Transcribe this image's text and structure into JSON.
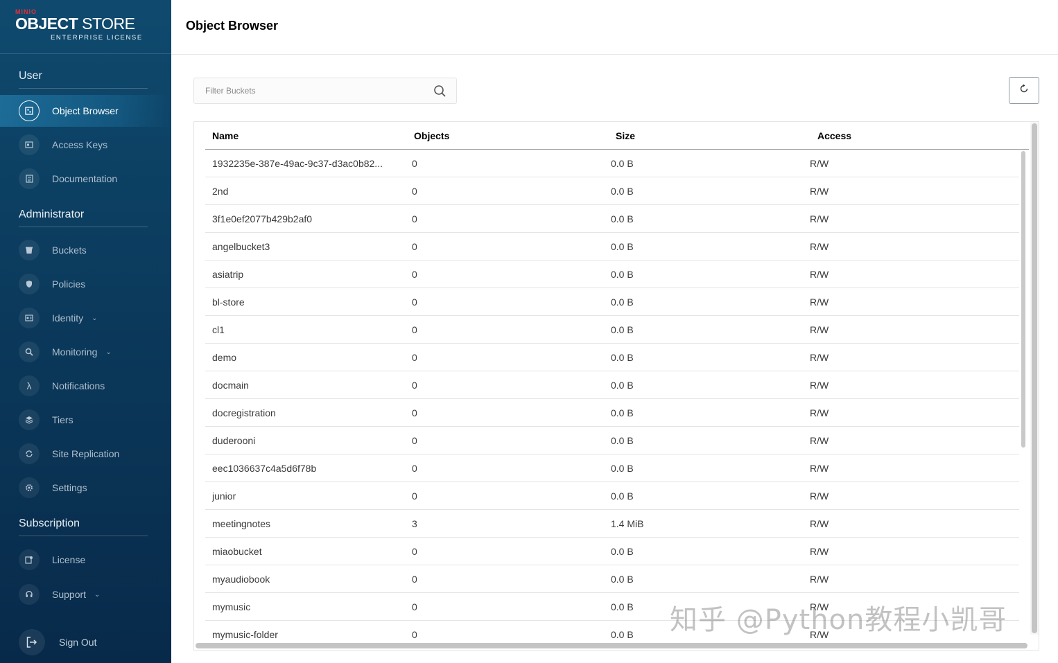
{
  "logo": {
    "brand": "MINIO",
    "title_bold": "OBJECT",
    "title_light": " STORE",
    "subtitle": "ENTERPRISE LICENSE"
  },
  "sidebar": {
    "sections": [
      {
        "title": "User"
      },
      {
        "title": "Administrator"
      },
      {
        "title": "Subscription"
      }
    ],
    "items": [
      {
        "label": "Object Browser",
        "icon": "object-browser-icon",
        "active": true
      },
      {
        "label": "Access Keys",
        "icon": "access-keys-icon"
      },
      {
        "label": "Documentation",
        "icon": "documentation-icon"
      },
      {
        "label": "Buckets",
        "icon": "buckets-icon"
      },
      {
        "label": "Policies",
        "icon": "policies-icon"
      },
      {
        "label": "Identity",
        "icon": "identity-icon",
        "expandable": true
      },
      {
        "label": "Monitoring",
        "icon": "monitoring-icon",
        "expandable": true
      },
      {
        "label": "Notifications",
        "icon": "lambda-icon"
      },
      {
        "label": "Tiers",
        "icon": "tiers-icon"
      },
      {
        "label": "Site Replication",
        "icon": "site-replication-icon"
      },
      {
        "label": "Settings",
        "icon": "gear-icon"
      },
      {
        "label": "License",
        "icon": "license-icon"
      },
      {
        "label": "Support",
        "icon": "support-icon",
        "expandable": true
      }
    ],
    "sign_out": "Sign Out"
  },
  "header": {
    "title": "Object Browser"
  },
  "filter": {
    "placeholder": "Filter Buckets"
  },
  "table": {
    "columns": [
      "Name",
      "Objects",
      "Size",
      "Access"
    ],
    "rows": [
      [
        "1932235e-387e-49ac-9c37-d3ac0b82...",
        "0",
        "0.0 B",
        "R/W"
      ],
      [
        "2nd",
        "0",
        "0.0 B",
        "R/W"
      ],
      [
        "3f1e0ef2077b429b2af0",
        "0",
        "0.0 B",
        "R/W"
      ],
      [
        "angelbucket3",
        "0",
        "0.0 B",
        "R/W"
      ],
      [
        "asiatrip",
        "0",
        "0.0 B",
        "R/W"
      ],
      [
        "bl-store",
        "0",
        "0.0 B",
        "R/W"
      ],
      [
        "cl1",
        "0",
        "0.0 B",
        "R/W"
      ],
      [
        "demo",
        "0",
        "0.0 B",
        "R/W"
      ],
      [
        "docmain",
        "0",
        "0.0 B",
        "R/W"
      ],
      [
        "docregistration",
        "0",
        "0.0 B",
        "R/W"
      ],
      [
        "duderooni",
        "0",
        "0.0 B",
        "R/W"
      ],
      [
        "eec1036637c4a5d6f78b",
        "0",
        "0.0 B",
        "R/W"
      ],
      [
        "junior",
        "0",
        "0.0 B",
        "R/W"
      ],
      [
        "meetingnotes",
        "3",
        "1.4 MiB",
        "R/W"
      ],
      [
        "miaobucket",
        "0",
        "0.0 B",
        "R/W"
      ],
      [
        "myaudiobook",
        "0",
        "0.0 B",
        "R/W"
      ],
      [
        "mymusic",
        "0",
        "0.0 B",
        "R/W"
      ],
      [
        "mymusic-folder",
        "0",
        "0.0 B",
        "R/W"
      ]
    ]
  },
  "watermark": "知乎 @Python教程小凯哥",
  "colors": {
    "sidebar": "#0b3a5c",
    "accent": "#1f86b4"
  }
}
